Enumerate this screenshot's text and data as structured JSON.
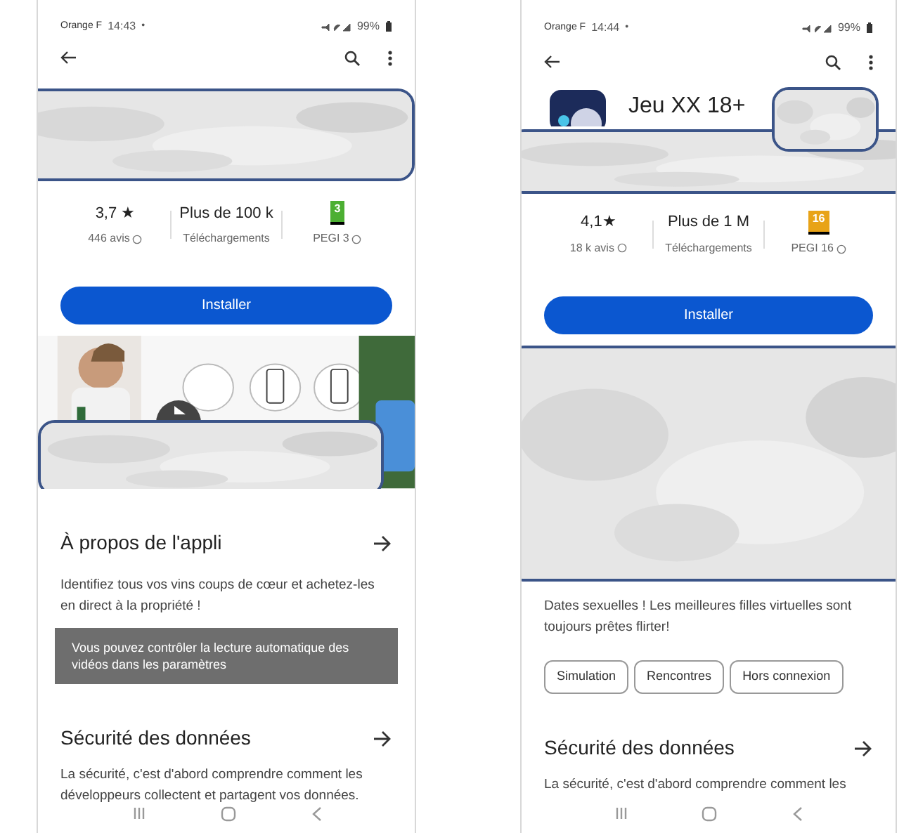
{
  "phones": [
    {
      "status_bar": {
        "carrier": "Orange F",
        "time": "14:43",
        "dot": "•",
        "battery": "99%"
      },
      "stats": [
        {
          "kind": "rating",
          "value": "3,7 ★",
          "label": "446 avis"
        },
        {
          "kind": "plain",
          "value": "Plus de 100 k",
          "label": "Téléchargements"
        },
        {
          "kind": "pegi",
          "badge": "3",
          "color": "#4caf32",
          "label": "PEGI 3"
        }
      ],
      "install_button": "Installer",
      "media": {
        "kind": "video"
      },
      "about": {
        "title": "À propos de l'appli",
        "text": "Identifiez tous vos vins coups de cœur et achetez-les en direct à la propriété !"
      },
      "tooltip": "Vous pouvez contrôler la lecture automatique des vidéos dans les paramètres",
      "data_safety": {
        "title": "Sécurité des données",
        "text": "La sécurité, c'est d'abord comprendre comment les développeurs collectent et partagent vos données."
      }
    },
    {
      "status_bar": {
        "carrier": "Orange F",
        "time": "14:44",
        "dot": "•",
        "battery": "99%"
      },
      "app_title": "Jeu XX 18+",
      "stats": [
        {
          "kind": "rating",
          "value": "4,1★",
          "label": "18 k avis"
        },
        {
          "kind": "plain",
          "value": "Plus de 1 M",
          "label": "Téléchargements"
        },
        {
          "kind": "pegi",
          "badge": "16",
          "color": "#e8a317",
          "label": "PEGI 16"
        }
      ],
      "install_button": "Installer",
      "media": {
        "kind": "blurred"
      },
      "about": {
        "text": "Dates sexuelles ! Les meilleures filles virtuelles sont toujours prêtes flirter!"
      },
      "chips": [
        "Simulation",
        "Rencontres",
        "Hors connexion"
      ],
      "data_safety": {
        "title": "Sécurité des données",
        "text": "La sécurité, c'est d'abord comprendre comment les"
      }
    }
  ]
}
